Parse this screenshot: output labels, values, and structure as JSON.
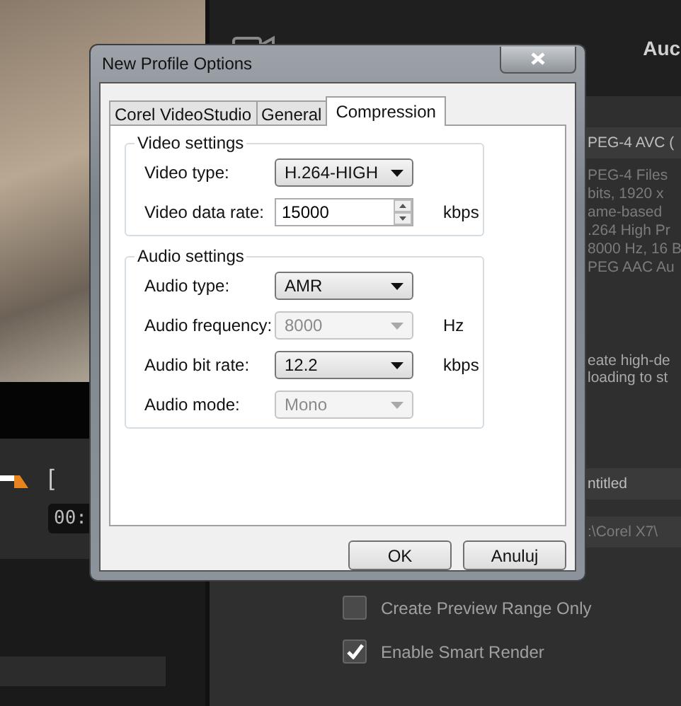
{
  "preview": {
    "mark_in": "[",
    "timecode": "00:"
  },
  "right_panel": {
    "heading": "Auc",
    "format": "PEG-4 AVC (",
    "properties": [
      "PEG-4 Files",
      "bits, 1920 x",
      "ame-based",
      ".264 High Pr",
      "8000 Hz, 16 B",
      "PEG AAC Au"
    ],
    "description": [
      "eate high-de",
      "loading to st"
    ],
    "file_name": "ntitled",
    "folder": ":\\Corel X7\\",
    "options": [
      {
        "label": "Create Preview Range Only",
        "checked": false
      },
      {
        "label": "Enable Smart Render",
        "checked": true
      }
    ]
  },
  "dialog": {
    "title": "New Profile Options",
    "tabs": [
      {
        "label": "Corel VideoStudio",
        "selected": false
      },
      {
        "label": "General",
        "selected": false
      },
      {
        "label": "Compression",
        "selected": true
      }
    ],
    "groups": [
      {
        "title": "Video settings",
        "fields": [
          {
            "kind": "dropdown",
            "label": "Video type:",
            "value": "H.264-HIGH",
            "disabled": false
          },
          {
            "kind": "spinner",
            "label": "Video data rate:",
            "value": "15000",
            "unit": "kbps"
          }
        ]
      },
      {
        "title": "Audio settings",
        "fields": [
          {
            "kind": "dropdown",
            "label": "Audio type:",
            "value": "AMR",
            "disabled": false
          },
          {
            "kind": "dropdown",
            "label": "Audio frequency:",
            "value": "8000",
            "disabled": true,
            "unit": "Hz"
          },
          {
            "kind": "dropdown",
            "label": "Audio bit rate:",
            "value": "12.2",
            "disabled": false,
            "unit": "kbps"
          },
          {
            "kind": "dropdown",
            "label": "Audio mode:",
            "value": "Mono",
            "disabled": true
          }
        ]
      }
    ],
    "buttons": [
      "OK",
      "Anuluj"
    ]
  }
}
